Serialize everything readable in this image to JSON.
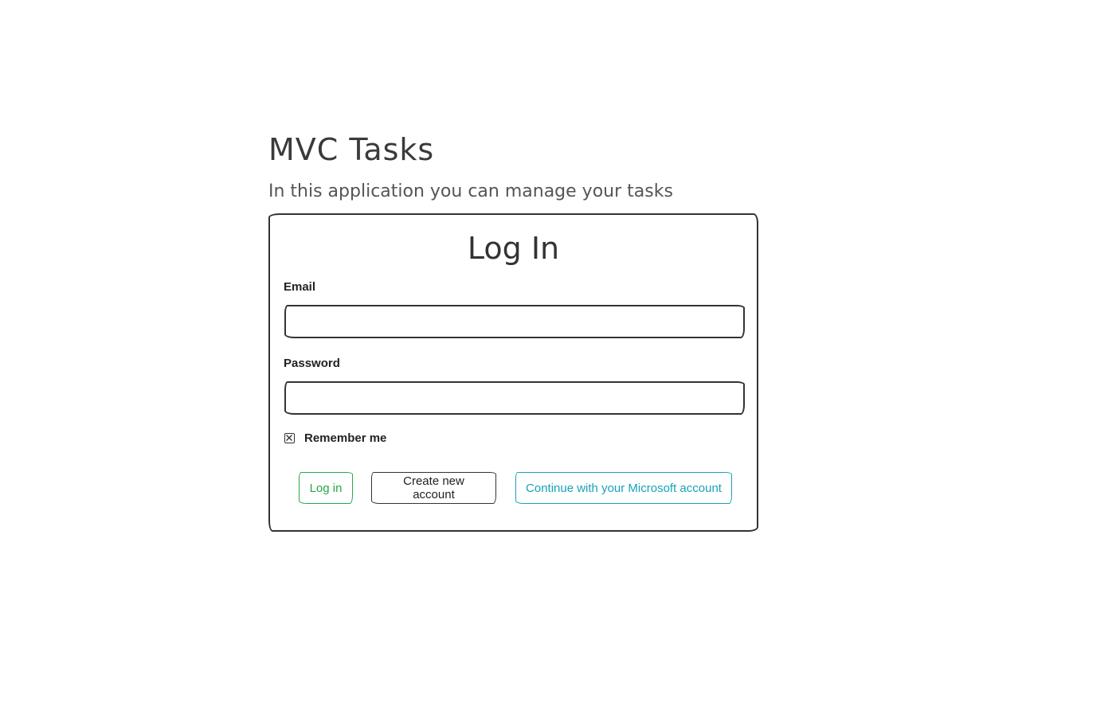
{
  "header": {
    "title": "MVC Tasks",
    "subtitle": "In this application you can manage your tasks"
  },
  "login": {
    "title": "Log In",
    "email_label": "Email",
    "email_value": "",
    "password_label": "Password",
    "password_value": "",
    "remember_label": "Remember me",
    "remember_checked": true,
    "buttons": {
      "login": "Log in",
      "create_account": "Create new account",
      "microsoft": "Continue with your Microsoft account"
    }
  },
  "colors": {
    "text": "#333333",
    "success": "#28a745",
    "info": "#17a2b8",
    "border": "#333333"
  },
  "icons": {
    "checkbox_mark": "x-mark-icon"
  }
}
